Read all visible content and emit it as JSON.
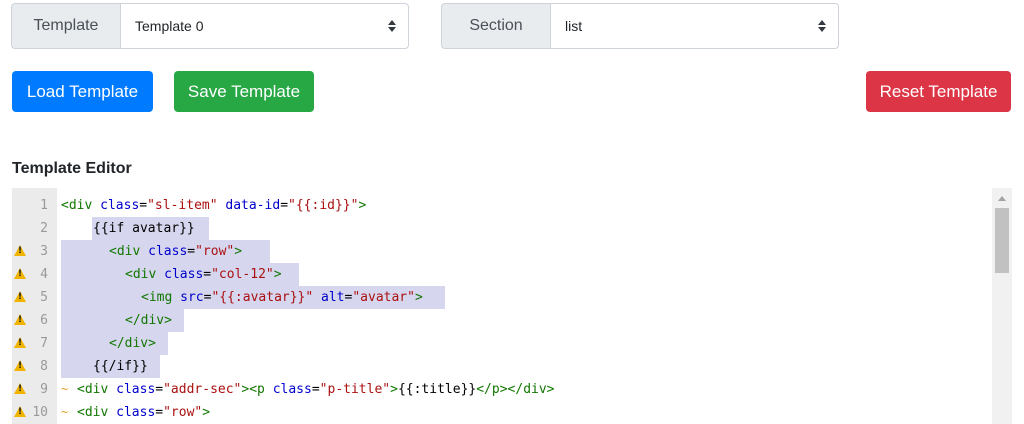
{
  "template_group": {
    "label": "Template",
    "selected": "Template 0"
  },
  "section_group": {
    "label": "Section",
    "selected": "list"
  },
  "buttons": {
    "load": "Load Template",
    "save": "Save Template",
    "reset": "Reset Template"
  },
  "editor": {
    "title": "Template Editor",
    "lines": [
      {
        "num": "1",
        "warning": false
      },
      {
        "num": "2",
        "warning": false
      },
      {
        "num": "3",
        "warning": true
      },
      {
        "num": "4",
        "warning": true
      },
      {
        "num": "5",
        "warning": true
      },
      {
        "num": "6",
        "warning": true
      },
      {
        "num": "7",
        "warning": true
      },
      {
        "num": "8",
        "warning": true
      },
      {
        "num": "9",
        "warning": true
      },
      {
        "num": "10",
        "warning": true
      }
    ],
    "code": {
      "l1": {
        "a": "<div",
        "b": " class",
        "c": "=",
        "d": "\"sl-item\"",
        "e": " data-id",
        "f": "=",
        "g": "\"{{:id}}\"",
        "h": ">"
      },
      "l2": {
        "a": "{{if avatar}}"
      },
      "l3": {
        "a": "<div",
        "b": " class",
        "c": "=",
        "d": "\"row\"",
        "e": ">"
      },
      "l4": {
        "a": "<div",
        "b": " class",
        "c": "=",
        "d": "\"col-12\"",
        "e": ">"
      },
      "l5": {
        "a": "<img",
        "b": " src",
        "c": "=",
        "d": "\"{{:avatar}}\"",
        "e": " alt",
        "f": "=",
        "g": "\"avatar\"",
        "h": ">"
      },
      "l6": {
        "a": "</div>"
      },
      "l7": {
        "a": "</div>"
      },
      "l8": {
        "a": "{{/if}}"
      },
      "l9": {
        "a": "<div",
        "b": " class",
        "c": "=",
        "d": "\"addr-sec\"",
        "e": "><p",
        "f": " class",
        "g": "=",
        "h": "\"p-title\"",
        "i": ">",
        "j": "{{:title}}",
        "k": "</p></div>"
      },
      "l10": {
        "a": "<div",
        "b": " class",
        "c": "=",
        "d": "\"row\"",
        "e": ">"
      }
    }
  }
}
